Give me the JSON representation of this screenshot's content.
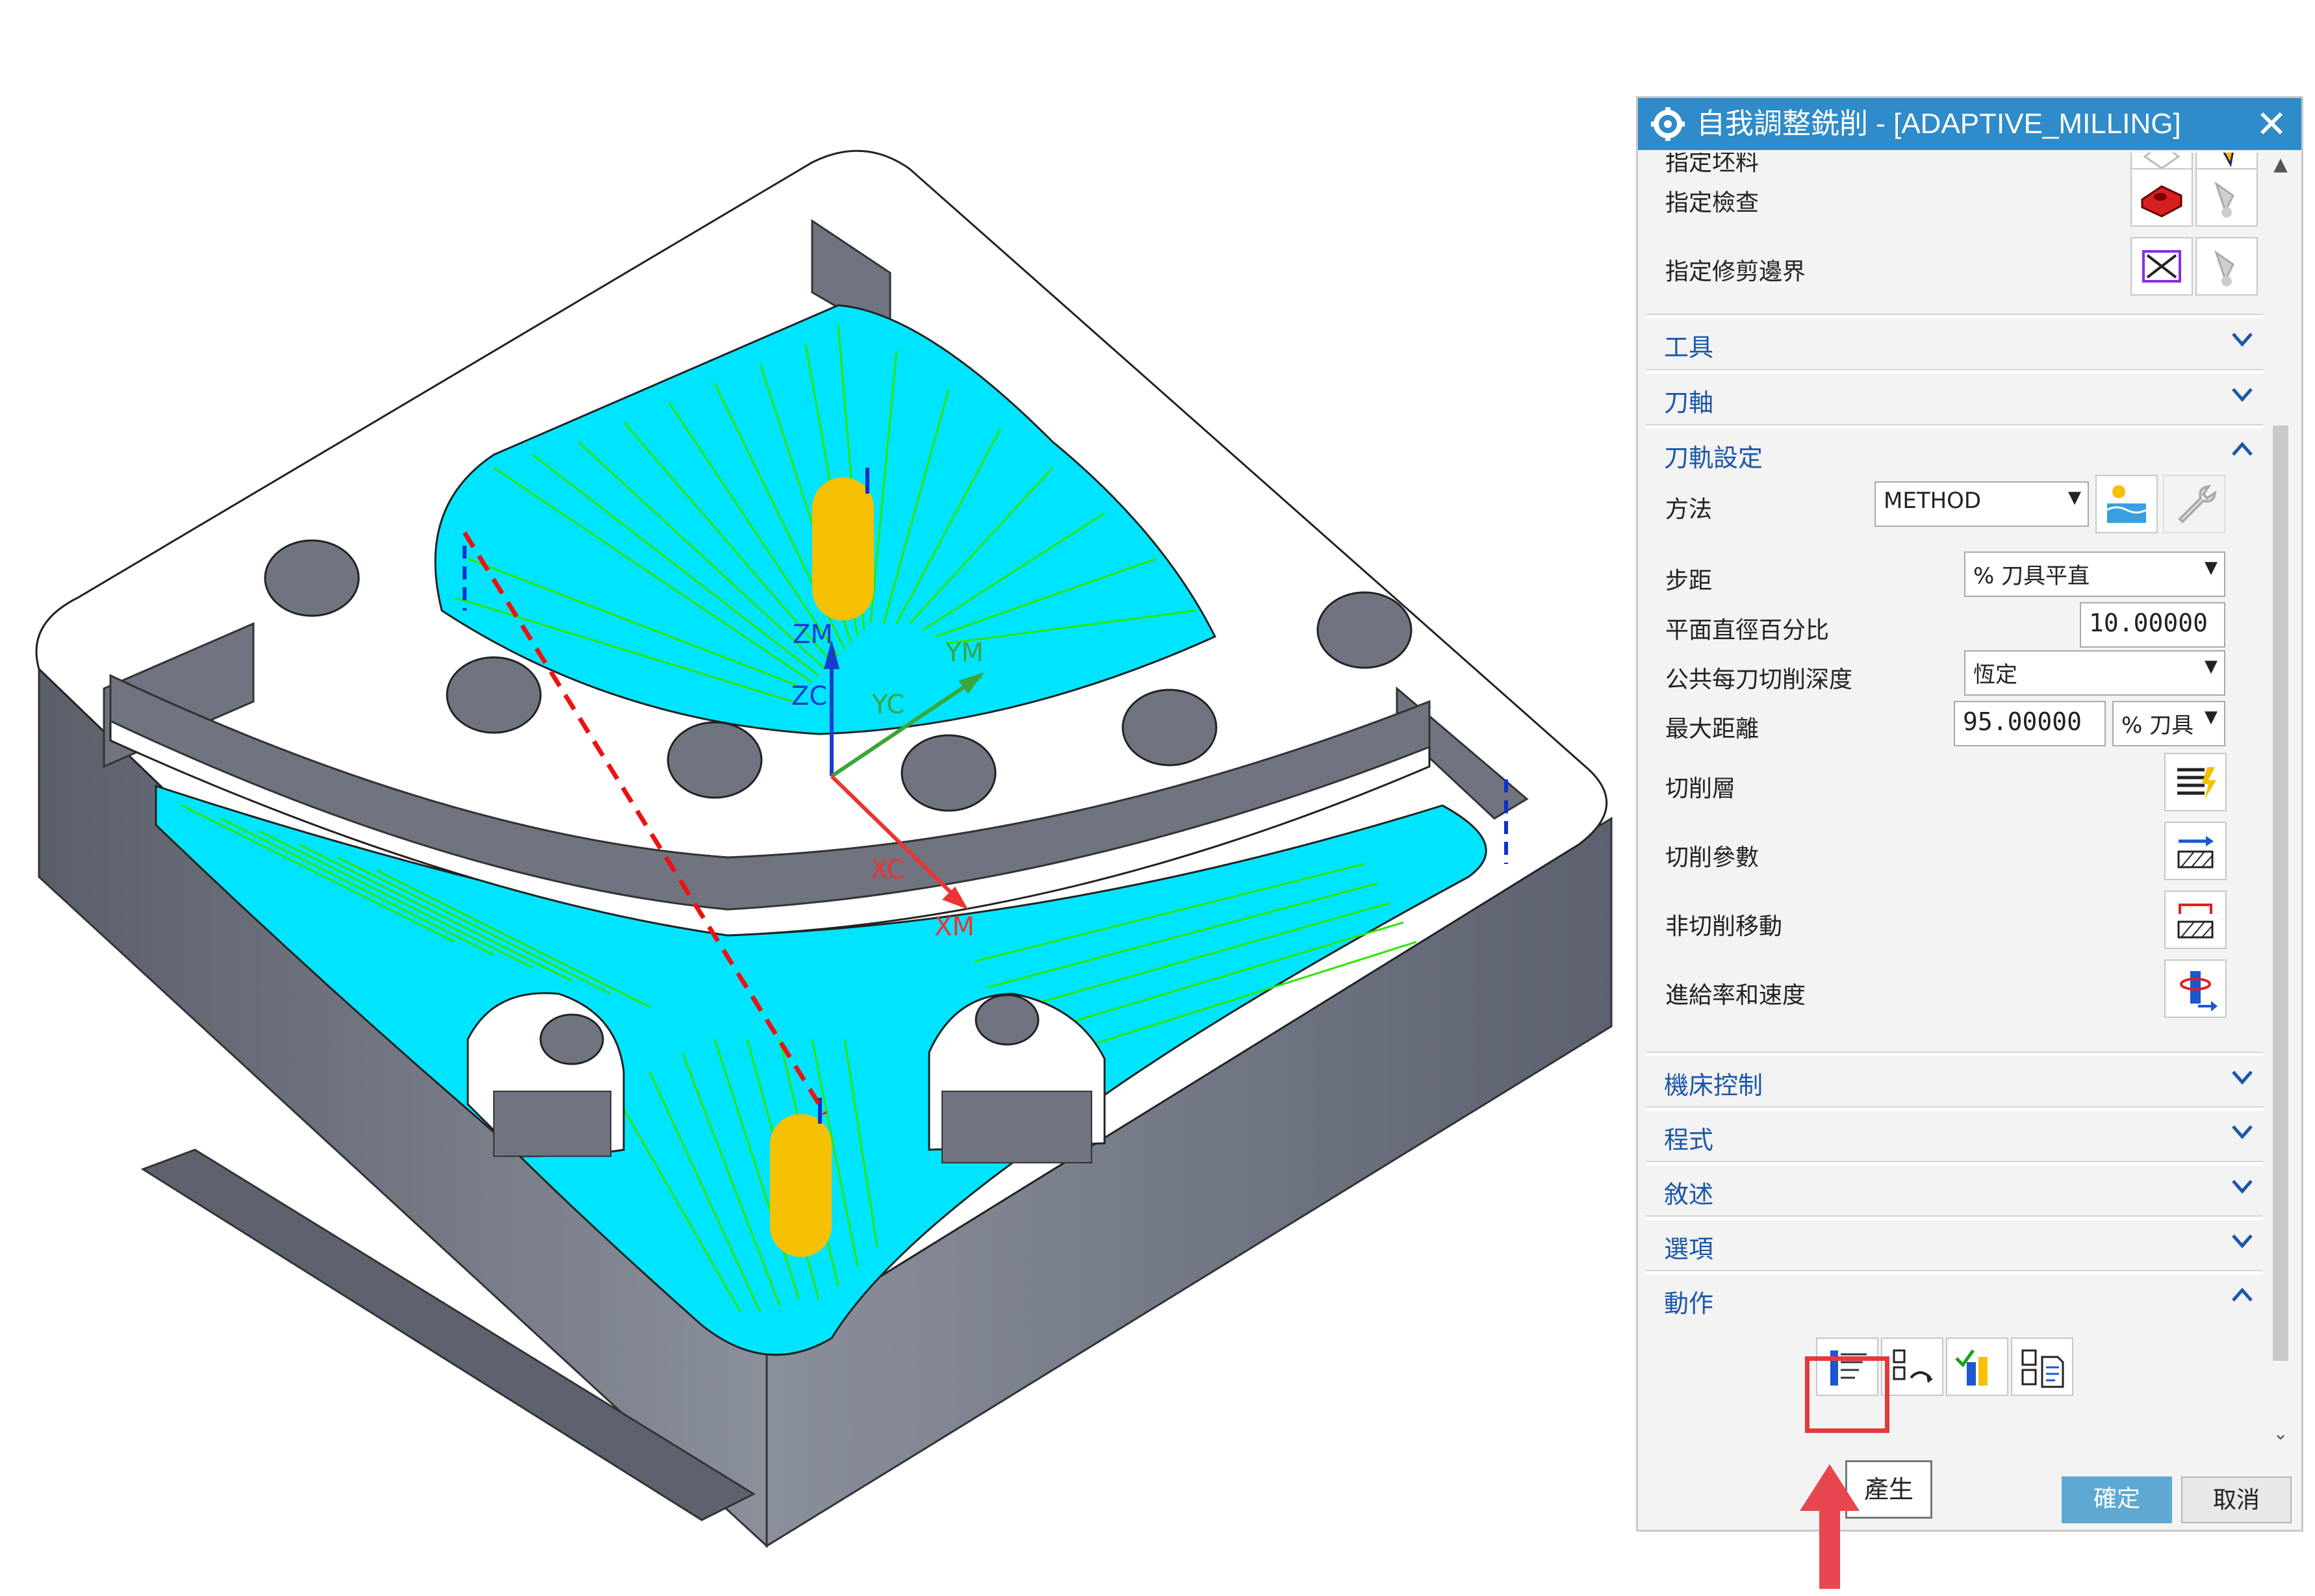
{
  "dialog": {
    "title": "自我調整銑削 - [ADAPTIVE_MILLING]",
    "close_glyph": "✕",
    "geometry_rows": [
      {
        "label": "指定坯料"
      },
      {
        "label": "指定檢查"
      },
      {
        "label": "指定修剪邊界"
      }
    ],
    "sections": {
      "tool": "工具",
      "axis": "刀軸",
      "path_settings": "刀軌設定",
      "machine_control": "機床控制",
      "program": "程式",
      "description": "敘述",
      "options": "選項",
      "actions": "動作"
    },
    "path_settings": {
      "method_label": "方法",
      "method_value": "METHOD",
      "stepover_label": "步距",
      "stepover_value": "% 刀具平直",
      "percent_label": "平面直徑百分比",
      "percent_value": "10.00000",
      "depth_label": "公共每刀切削深度",
      "depth_value": "恆定",
      "maxdist_label": "最大距離",
      "maxdist_value": "95.00000",
      "maxdist_unit": "% 刀具",
      "cut_levels_label": "切削層",
      "cut_params_label": "切削參數",
      "noncut_label": "非切削移動",
      "feeds_label": "進給率和速度"
    },
    "footer": {
      "ok": "確定",
      "cancel": "取消"
    },
    "tooltip": "產生"
  },
  "viewport": {
    "axes": {
      "zm": "ZM",
      "zc": "ZC",
      "ym": "YM",
      "yc": "YC",
      "xc": "XC",
      "xm": "XM"
    },
    "colors": {
      "part": "#6f7480",
      "floor": "#00e5ff",
      "toolpath": "#2ee600",
      "tool": "#f5c000"
    }
  }
}
